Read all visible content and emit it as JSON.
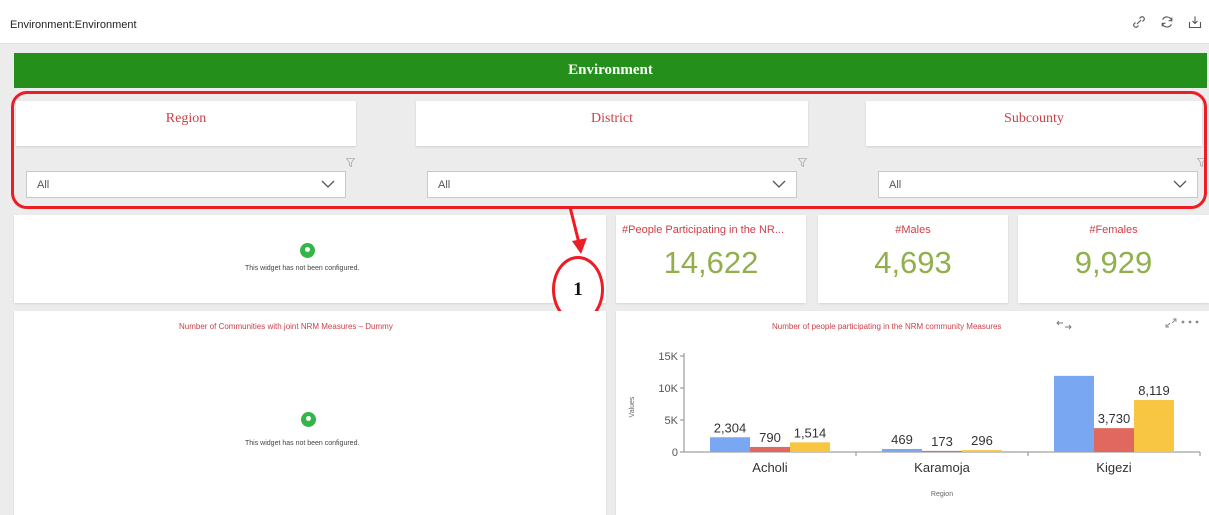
{
  "header": {
    "title": "Environment:Environment",
    "icons": [
      "link-icon",
      "refresh-icon",
      "export-icon"
    ]
  },
  "banner": {
    "title": "Environment"
  },
  "filters": [
    {
      "label": "Region",
      "value": "All"
    },
    {
      "label": "District",
      "value": "All"
    },
    {
      "label": "Subcounty",
      "value": "All"
    }
  ],
  "callout": {
    "label": "1"
  },
  "widgets": {
    "unconfigured_message": "This widget has not been configured."
  },
  "kpis": [
    {
      "title": "#People Participating in the NR...",
      "value": "14,622"
    },
    {
      "title": "#Males",
      "value": "4,693"
    },
    {
      "title": "#Females",
      "value": "9,929"
    }
  ],
  "communities_widget": {
    "title": "Number of Communities with joint NRM Measures – Dummy"
  },
  "chart_data": {
    "type": "bar",
    "title": "Number of people participating in the NRM community Measures",
    "xlabel": "Region",
    "ylabel": "Values",
    "categories": [
      "Acholi",
      "Karamoja",
      "Kigezi"
    ],
    "ylim": [
      0,
      15000
    ],
    "yticks": [
      "0",
      "5K",
      "10K",
      "15K"
    ],
    "grid": false,
    "series": [
      {
        "values": [
          2304,
          469,
          11900
        ],
        "color": "#7aa7f2"
      },
      {
        "values": [
          790,
          173,
          3730
        ],
        "color": "#e0685e"
      },
      {
        "values": [
          1514,
          296,
          8119
        ],
        "color": "#f8c643"
      }
    ],
    "data_labels": [
      [
        "2,304",
        "790",
        "1,514"
      ],
      [
        "469",
        "173",
        "296"
      ],
      [
        "",
        "3,730",
        "8,119"
      ]
    ]
  },
  "colors": {
    "banner": "#248f1a",
    "filter_label": "#cc3f47",
    "kpi_value": "#8fb04a",
    "highlight": "#ee1c24"
  }
}
